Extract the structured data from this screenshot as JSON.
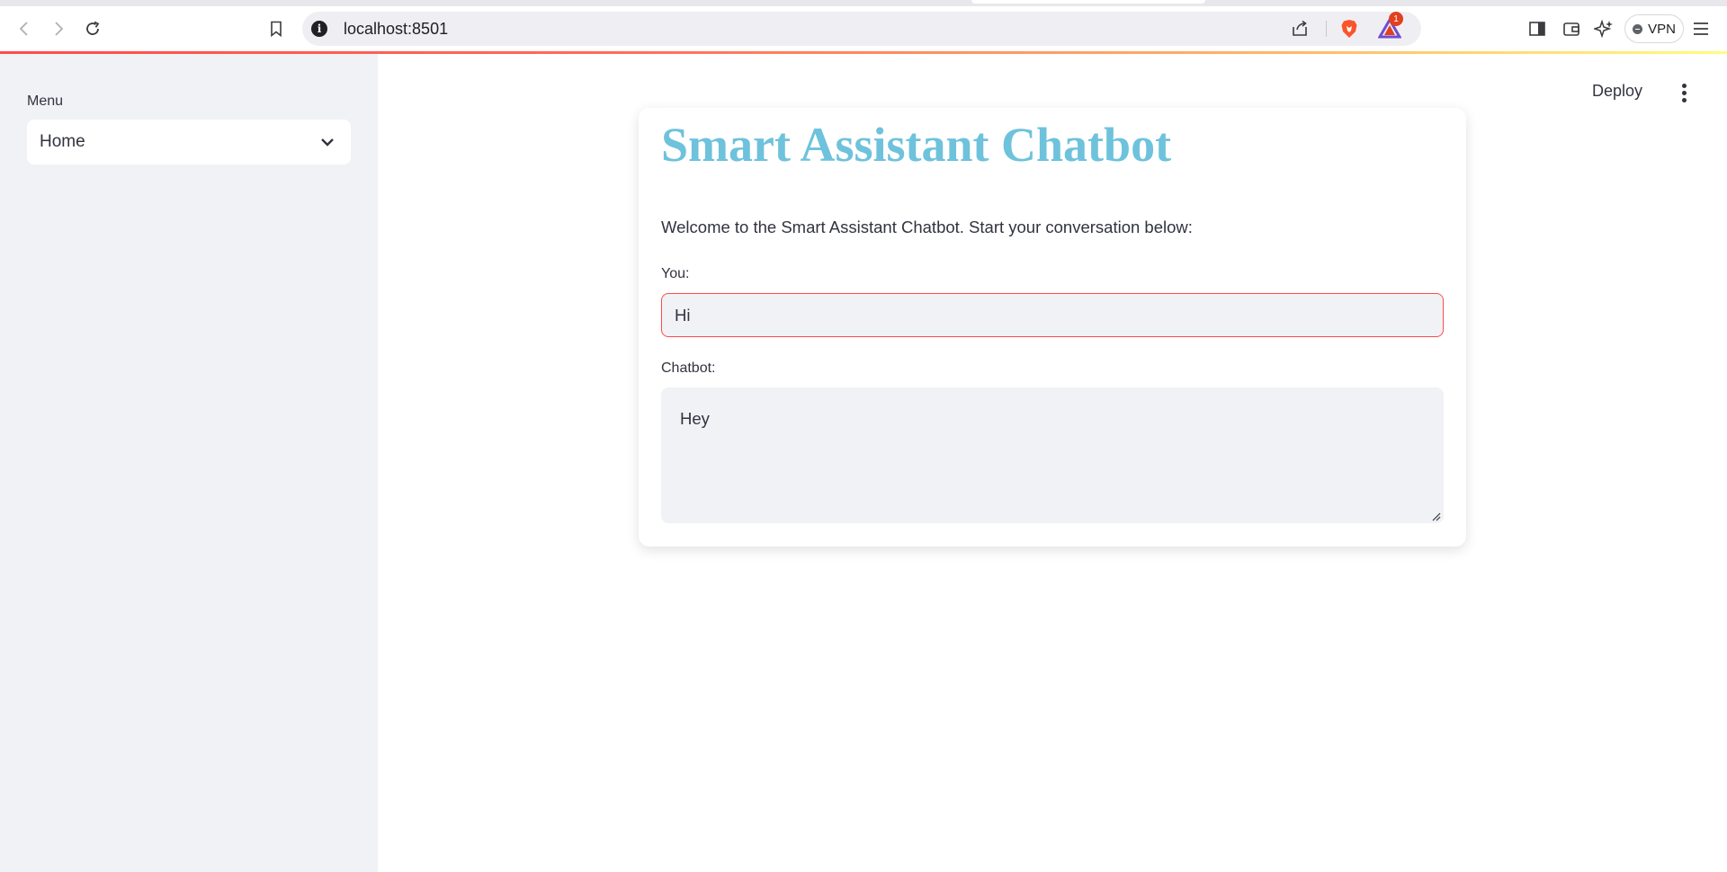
{
  "browser": {
    "url": "localhost:8501",
    "rewards_badge": "1",
    "vpn_label": "VPN"
  },
  "sidebar": {
    "menu_label": "Menu",
    "select": {
      "selected": "Home"
    }
  },
  "header": {
    "deploy_label": "Deploy"
  },
  "main": {
    "title": "Smart Assistant Chatbot",
    "intro": "Welcome to the Smart Assistant Chatbot. Start your conversation below:",
    "you_label": "You:",
    "you_value": "Hi",
    "bot_label": "Chatbot:",
    "bot_value": "Hey"
  },
  "colors": {
    "title": "#6ec2dc",
    "accent": "#ff4b4b",
    "sidebar_bg": "#f0f2f6"
  }
}
